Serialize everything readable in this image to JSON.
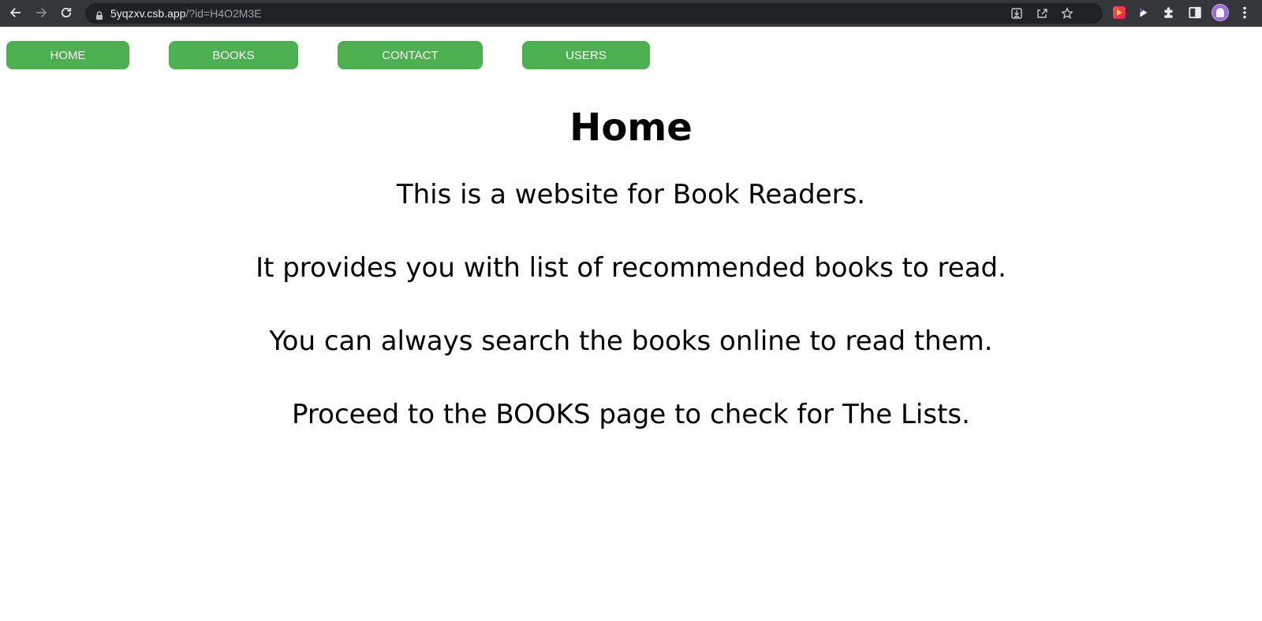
{
  "browser": {
    "url_host": "5yqzxv.csb.app",
    "url_path": "/?id=H4O2M3E"
  },
  "nav": {
    "items": [
      {
        "label": "HOME"
      },
      {
        "label": "BOOKS"
      },
      {
        "label": "CONTACT"
      },
      {
        "label": "USERS"
      }
    ],
    "button_color": "#4caf50"
  },
  "page": {
    "title": "Home",
    "paragraphs": [
      "This is a website for Book Readers.",
      "It provides you with list of recommended books to read.",
      "You can always search the books online to read them.",
      "Proceed to the BOOKS page to check for The Lists."
    ]
  },
  "icons": [
    "back-icon",
    "forward-icon",
    "reload-icon",
    "lock-icon",
    "install-icon",
    "share-icon",
    "star-icon",
    "extension-icon",
    "puzzle-icon",
    "side-panel-icon",
    "avatar",
    "more-icon"
  ]
}
